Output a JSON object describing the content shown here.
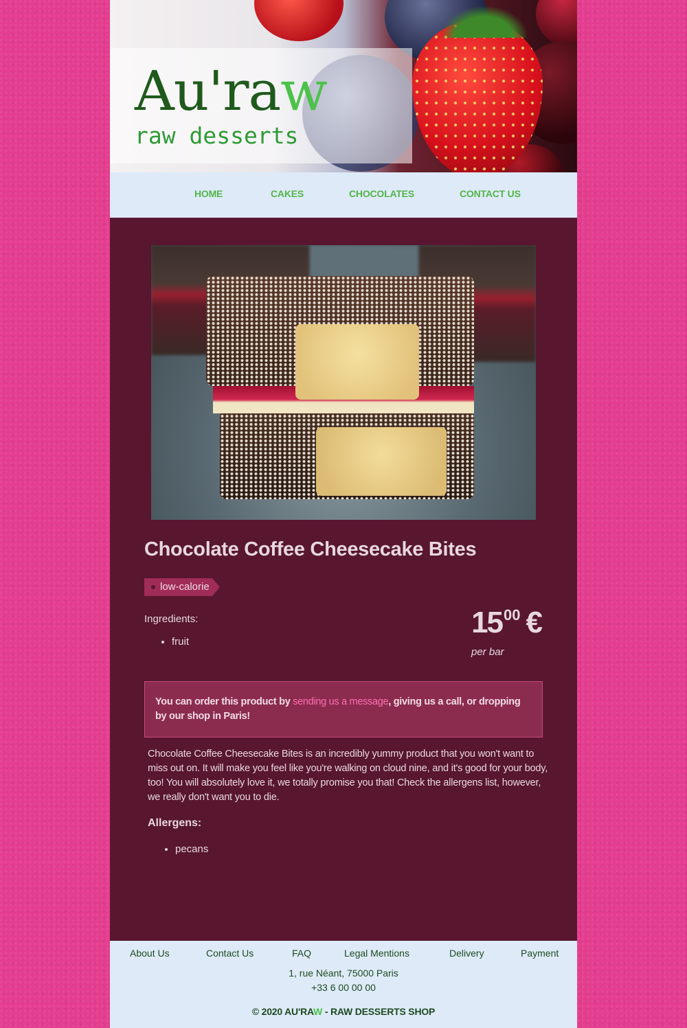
{
  "brand": {
    "logo_main": "Au'ra",
    "logo_accent": "w",
    "tagline": "raw desserts"
  },
  "nav": {
    "items": [
      {
        "label": "HOME"
      },
      {
        "label": "CAKES"
      },
      {
        "label": "CHOCOLATES"
      },
      {
        "label": "CONTACT US"
      }
    ]
  },
  "product": {
    "image_icon": "cheesecake-photo",
    "title": "Chocolate Coffee Cheesecake Bites",
    "tag": "low-calorie",
    "ingredients_label": "Ingredients:",
    "ingredients": [
      "fruit"
    ],
    "price_integer": "15",
    "price_decimals": "00",
    "currency": "€",
    "price_unit": "per bar",
    "order_text_before": "You can order this product by ",
    "order_link": "sending us a message",
    "order_text_after": ", giving us a call, or dropping by our shop in Paris!",
    "description": "Chocolate Coffee Cheesecake Bites is an incredibly yummy product that you won't want to miss out on. It will make you feel like you're walking on cloud nine, and it's good for your body, too! You will absolutely love it, we totally promise you that! Check the allergens list, however, we really don't want you to die.",
    "allergens_label": "Allergens:",
    "allergens": [
      "pecans"
    ]
  },
  "footer": {
    "links": [
      {
        "label": "About Us"
      },
      {
        "label": "Contact Us"
      },
      {
        "label": "FAQ"
      },
      {
        "label": "Legal Mentions"
      },
      {
        "label": "Delivery"
      },
      {
        "label": "Payment"
      }
    ],
    "address": "1, rue Néant, 75000 Paris",
    "phone": "+33 6 00 00 00",
    "copyright_before": "© 2020 AU'RA",
    "copyright_accent": "W",
    "copyright_after": " - RAW DESSERTS SHOP"
  },
  "colors": {
    "page_background": "#e43d8f",
    "content_background": "#58162f",
    "nav_background": "#deeaf8",
    "brand_green": "#4cc24a",
    "link_pink": "#ff6fb0",
    "tag_background": "#a02c58"
  }
}
